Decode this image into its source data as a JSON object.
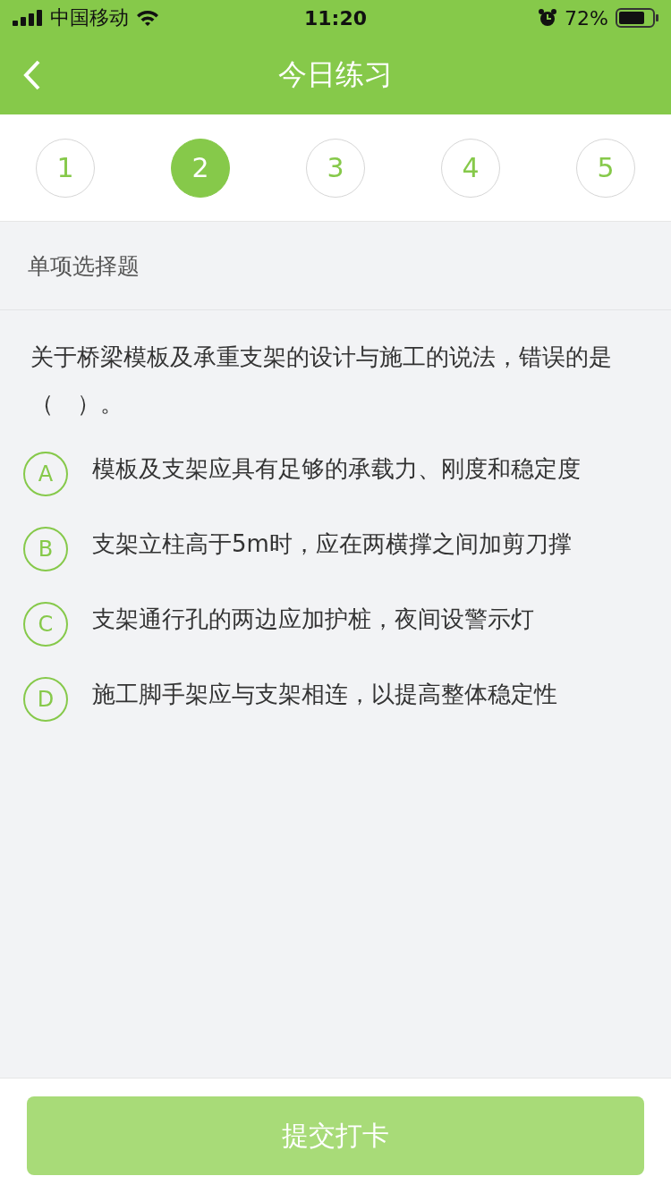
{
  "status_bar": {
    "carrier": "中国移动",
    "time": "11:20",
    "battery": "72%"
  },
  "nav": {
    "title": "今日练习"
  },
  "steps": [
    {
      "label": "1",
      "selected": false
    },
    {
      "label": "2",
      "selected": true
    },
    {
      "label": "3",
      "selected": false
    },
    {
      "label": "4",
      "selected": false
    },
    {
      "label": "5",
      "selected": false
    }
  ],
  "question": {
    "type": "单项选择题",
    "text": "关于桥梁模板及承重支架的设计与施工的说法，错误的是（　）。",
    "options": [
      {
        "letter": "A",
        "text": "模板及支架应具有足够的承载力、刚度和稳定度",
        "selected": false
      },
      {
        "letter": "B",
        "text": "支架立柱高于5m时，应在两横撑之间加剪刀撑",
        "selected": false
      },
      {
        "letter": "C",
        "text": "支架通行孔的两边应加护桩，夜间设警示灯",
        "selected": false
      },
      {
        "letter": "D",
        "text": "施工脚手架应与支架相连，以提高整体稳定性",
        "selected": false
      }
    ]
  },
  "submit": {
    "label": "提交打卡",
    "disabled": true
  }
}
